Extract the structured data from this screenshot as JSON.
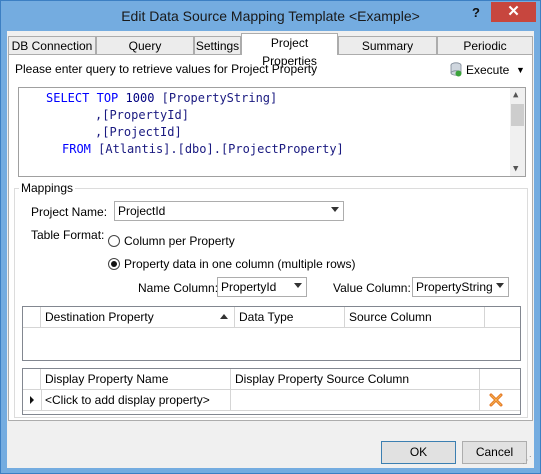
{
  "window": {
    "title": "Edit Data Source Mapping Template <Example>",
    "help_label": "?",
    "close_label": "✕"
  },
  "tabs": [
    {
      "label": "DB Connection"
    },
    {
      "label": "Query Parameters"
    },
    {
      "label": "Settings"
    },
    {
      "label": "Project Properties",
      "active": true
    },
    {
      "label": "Summary Variables"
    },
    {
      "label": "Periodic Variables"
    }
  ],
  "query": {
    "prompt": "Please enter query to retrieve values for Project Property",
    "execute_label": "Execute",
    "lines": [
      {
        "kw1": "SELECT",
        "kw2": "TOP",
        "num": "1000",
        "rest": "[PropertyString]"
      },
      {
        "rest": ",[PropertyId]"
      },
      {
        "rest": ",[ProjectId]"
      },
      {
        "kw1": "FROM",
        "rest": "[Atlantis].[dbo].[ProjectProperty]"
      }
    ]
  },
  "mappings": {
    "group_label": "Mappings",
    "project_name_label": "Project Name:",
    "project_name_value": "ProjectId",
    "table_format_label": "Table Format:",
    "radio_column_per_property": "Column per Property",
    "radio_property_data": "Property data in one column (multiple rows)",
    "selected_format": "Property data in one column (multiple rows)",
    "name_column_label": "Name Column:",
    "name_column_value": "PropertyId",
    "value_column_label": "Value Column:",
    "value_column_value": "PropertyString"
  },
  "property_grid": {
    "columns": [
      "Destination Property",
      "Data Type",
      "Source Column"
    ]
  },
  "display_grid": {
    "columns": [
      "Display Property Name",
      "Display Property Source Column"
    ],
    "rows": [
      {
        "name": "<Click to add display property>",
        "source": ""
      }
    ]
  },
  "buttons": {
    "ok_label": "OK",
    "cancel_label": "Cancel"
  },
  "colors": {
    "titlebar": "#74ace0",
    "close_button": "#c7463e",
    "sql_keyword": "#0000ff"
  }
}
